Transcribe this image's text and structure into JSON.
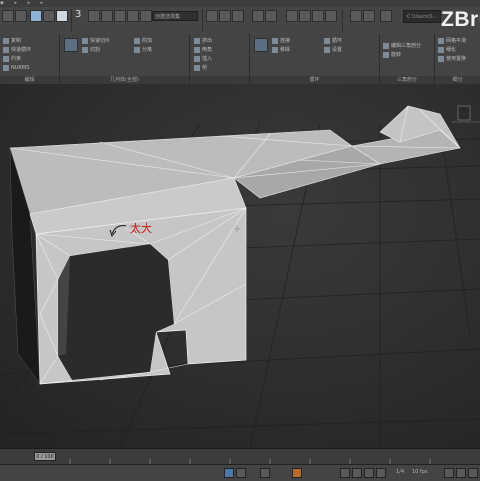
{
  "app": {
    "logo": "ZBru"
  },
  "toolbar": {
    "selection_set": "创建选择集",
    "search_placeholder": "C:\\Users\\S...",
    "frame_number": "3"
  },
  "ribbon": {
    "panels": [
      {
        "title": "编辑",
        "items": [
          "复制",
          "快速循环",
          "约束",
          "NURMS"
        ]
      },
      {
        "title": "几何体(全部)",
        "items": [
          "快速切片",
          "切割",
          "附加",
          "分离"
        ]
      },
      {
        "title": "",
        "items": [
          "挤出",
          "倒角",
          "插入",
          "桥"
        ]
      },
      {
        "title": "循环",
        "items": [
          "连接",
          "移除",
          "循环",
          "设置"
        ]
      },
      {
        "title": "三角剖分",
        "items": [
          "编辑三角剖分",
          "旋转"
        ]
      },
      {
        "title": "细分",
        "items": [
          "网格平滑",
          "细化",
          "使用置换"
        ]
      }
    ]
  },
  "viewport": {
    "annotation": "太大",
    "annotation_color": "#cc1111"
  },
  "timeline": {
    "slider_label": "0 / 100"
  },
  "statusbar": {
    "speed": "1/4",
    "fps": "10 fps"
  }
}
